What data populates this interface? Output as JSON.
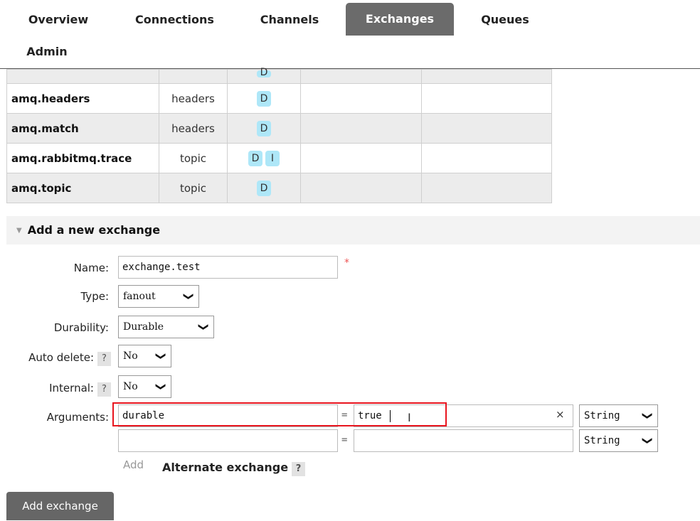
{
  "nav": {
    "tabs": [
      "Overview",
      "Connections",
      "Channels",
      "Exchanges",
      "Queues",
      "Admin"
    ],
    "active": "Exchanges"
  },
  "exchanges": [
    {
      "name": "amq.headers",
      "type": "headers",
      "features": [
        "D"
      ]
    },
    {
      "name": "amq.match",
      "type": "headers",
      "features": [
        "D"
      ]
    },
    {
      "name": "amq.rabbitmq.trace",
      "type": "topic",
      "features": [
        "D",
        "I"
      ]
    },
    {
      "name": "amq.topic",
      "type": "topic",
      "features": [
        "D"
      ]
    }
  ],
  "section": {
    "title": "Add a new exchange"
  },
  "form": {
    "name_label": "Name:",
    "name_value": "exchange.test",
    "required_mark": "*",
    "type_label": "Type:",
    "type_value": "fanout",
    "durability_label": "Durability:",
    "durability_value": "Durable",
    "auto_delete_label": "Auto delete:",
    "auto_delete_value": "No",
    "internal_label": "Internal:",
    "internal_value": "No",
    "help_mark": "?",
    "arguments_label": "Arguments:",
    "arguments": [
      {
        "key": "durable",
        "value": "true",
        "type": "String"
      },
      {
        "key": "",
        "value": "",
        "type": "String"
      }
    ],
    "eq": "=",
    "remove_mark": "×",
    "add_link": "Add",
    "alternate_exchange_label": "Alternate exchange",
    "submit_label": "Add exchange"
  },
  "icons": {
    "dropdown": "chevron-down-icon",
    "section": "triangle-down-icon",
    "cursor": "text-cursor-icon"
  }
}
